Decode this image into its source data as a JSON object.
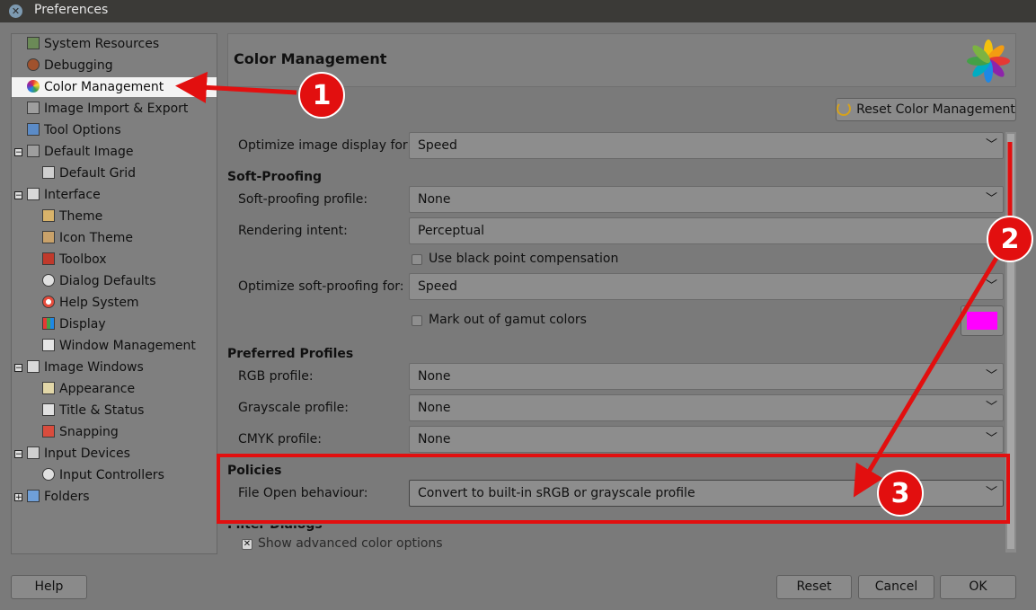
{
  "window": {
    "title": "Preferences"
  },
  "sidebar": {
    "items": [
      {
        "label": "System Resources",
        "icon": "system-resources-icon"
      },
      {
        "label": "Debugging",
        "icon": "bug-icon"
      },
      {
        "label": "Color Management",
        "icon": "color-management-icon",
        "selected": true
      },
      {
        "label": "Image Import & Export",
        "icon": "image-import-export-icon"
      },
      {
        "label": "Tool Options",
        "icon": "tool-options-icon"
      },
      {
        "label": "Default Image",
        "icon": "default-image-icon",
        "expanded": true
      },
      {
        "label": "Default Grid",
        "icon": "grid-icon"
      },
      {
        "label": "Interface",
        "icon": "interface-icon",
        "expanded": true
      },
      {
        "label": "Theme",
        "icon": "theme-icon"
      },
      {
        "label": "Icon Theme",
        "icon": "icon-theme-icon"
      },
      {
        "label": "Toolbox",
        "icon": "toolbox-icon"
      },
      {
        "label": "Dialog Defaults",
        "icon": "dialog-defaults-icon"
      },
      {
        "label": "Help System",
        "icon": "help-system-icon"
      },
      {
        "label": "Display",
        "icon": "display-icon"
      },
      {
        "label": "Window Management",
        "icon": "window-management-icon"
      },
      {
        "label": "Image Windows",
        "icon": "image-windows-icon",
        "expanded": true
      },
      {
        "label": "Appearance",
        "icon": "appearance-icon"
      },
      {
        "label": "Title & Status",
        "icon": "title-status-icon"
      },
      {
        "label": "Snapping",
        "icon": "snapping-icon"
      },
      {
        "label": "Input Devices",
        "icon": "input-devices-icon",
        "expanded": true
      },
      {
        "label": "Input Controllers",
        "icon": "input-controllers-icon"
      },
      {
        "label": "Folders",
        "icon": "folders-icon",
        "expanded": false
      }
    ]
  },
  "header": {
    "title": "Color Management"
  },
  "reset_color_management_label": "Reset Color Management",
  "settings": {
    "optimize_display": {
      "label": "Optimize image display for:",
      "value": "Speed"
    },
    "soft_proofing": {
      "heading": "Soft-Proofing",
      "profile": {
        "label": "Soft-proofing profile:",
        "value": "None"
      },
      "intent": {
        "label": "Rendering intent:",
        "value": "Perceptual"
      },
      "black_point": {
        "label": "Use black point compensation",
        "checked": false
      },
      "optimize": {
        "label": "Optimize soft-proofing for:",
        "value": "Speed"
      },
      "gamut": {
        "label": "Mark out of gamut colors",
        "checked": false,
        "color": "#ff00ff"
      }
    },
    "preferred_profiles": {
      "heading": "Preferred Profiles",
      "rgb": {
        "label": "RGB profile:",
        "value": "None"
      },
      "grayscale": {
        "label": "Grayscale profile:",
        "value": "None"
      },
      "cmyk": {
        "label": "CMYK profile:",
        "value": "None"
      }
    },
    "policies": {
      "heading": "Policies",
      "file_open": {
        "label": "File Open behaviour:",
        "value": "Convert to built-in sRGB or grayscale profile"
      }
    },
    "filter_dialogs": {
      "heading": "Filter Dialogs",
      "show_advanced": {
        "label": "Show advanced color options",
        "checked": true
      }
    }
  },
  "buttons": {
    "help": "Help",
    "reset": "Reset",
    "cancel": "Cancel",
    "ok": "OK"
  },
  "annotations": {
    "color": "#e20f0f",
    "callouts": [
      "1",
      "2",
      "3"
    ]
  }
}
